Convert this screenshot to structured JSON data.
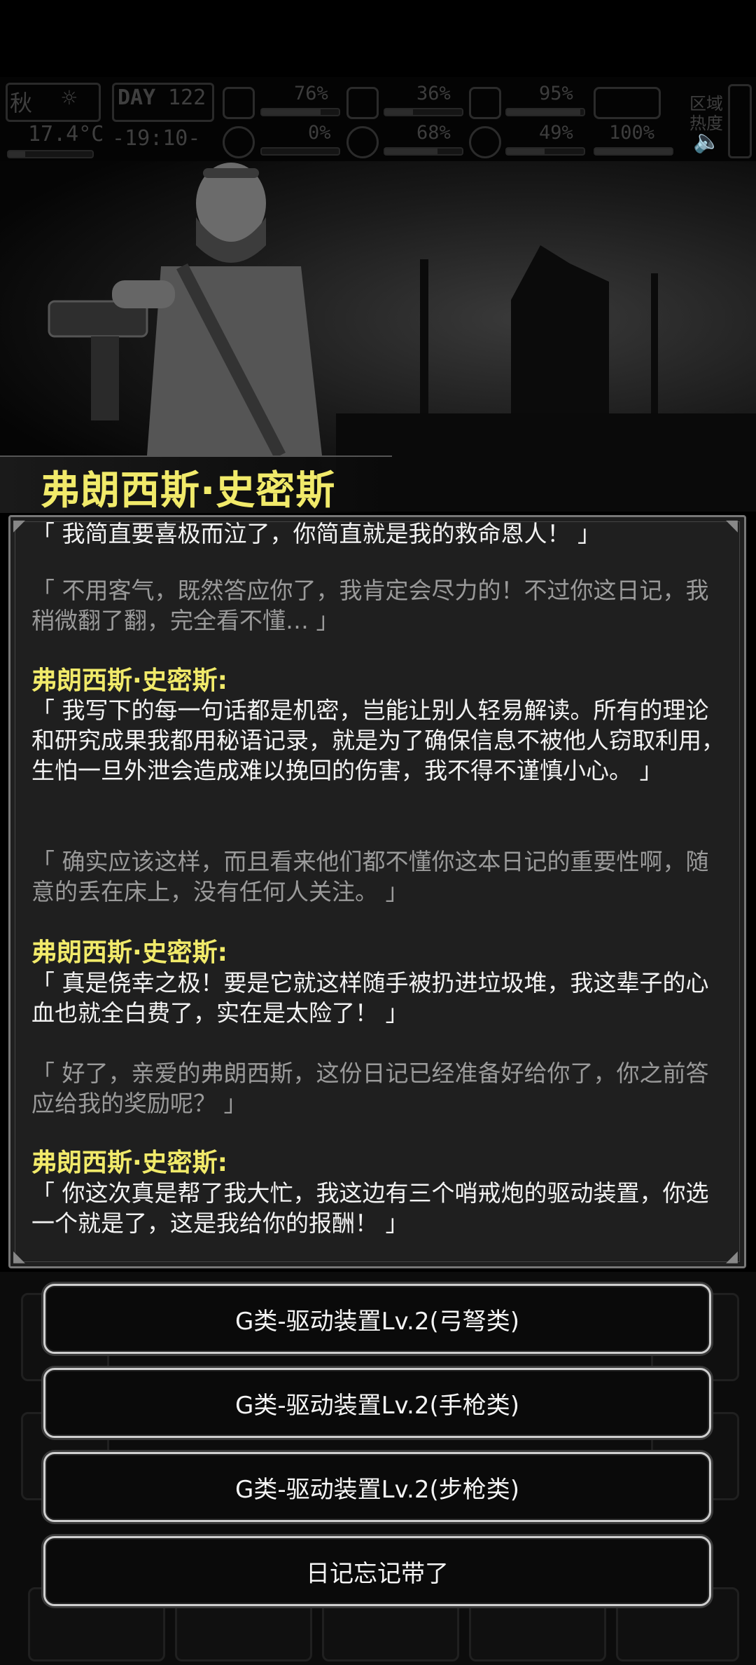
{
  "hud": {
    "season": "秋",
    "temperature": "17.4°C",
    "day_label": "DAY",
    "day_number": "122",
    "time": "-19:10-",
    "stats_top": [
      "76%",
      "36%",
      "95%"
    ],
    "stats_bottom": [
      "0%",
      "68%",
      "49%",
      "100%"
    ],
    "zone_label": "区域",
    "heat_label": "热度"
  },
  "npc": {
    "name": "弗朗西斯·史密斯"
  },
  "dialog": [
    {
      "type": "npc",
      "text": "「 我简直要喜极而泣了，你简直就是我的救命恩人！ 」"
    },
    {
      "type": "player",
      "text": "「 不用客气，既然答应你了，我肯定会尽力的！不过你这日记，我稍微翻了翻，完全看不懂… 」"
    },
    {
      "type": "speaker",
      "text": "弗朗西斯·史密斯:"
    },
    {
      "type": "npc",
      "text": "「 我写下的每一句话都是机密，岂能让别人轻易解读。所有的理论和研究成果我都用秘语记录，就是为了确保信息不被他人窃取利用，生怕一旦外泄会造成难以挽回的伤害，我不得不谨慎小心。 」"
    },
    {
      "type": "player",
      "text": "「 确实应该这样，而且看来他们都不懂你这本日记的重要性啊，随意的丢在床上，没有任何人关注。 」"
    },
    {
      "type": "speaker",
      "text": "弗朗西斯·史密斯:"
    },
    {
      "type": "npc",
      "text": "「 真是侥幸之极！要是它就这样随手被扔进垃圾堆，我这辈子的心血也就全白费了，实在是太险了！ 」"
    },
    {
      "type": "player",
      "text": "「 好了，亲爱的弗朗西斯，这份日记已经准备好给你了，你之前答应给我的奖励呢？ 」"
    },
    {
      "type": "speaker",
      "text": "弗朗西斯·史密斯:"
    },
    {
      "type": "npc",
      "text": "「 你这次真是帮了我大忙，我这边有三个哨戒炮的驱动装置，你选一个就是了，这是我给你的报酬！ 」"
    }
  ],
  "choices": [
    "G类-驱动装置Lv.2(弓弩类)",
    "G类-驱动装置Lv.2(手枪类)",
    "G类-驱动装置Lv.2(步枪类)",
    "日记忘记带了"
  ],
  "colors": {
    "speaker": "#f1ea6a",
    "npc_text": "#f2f2f2",
    "player_text": "#9a9a9a"
  }
}
